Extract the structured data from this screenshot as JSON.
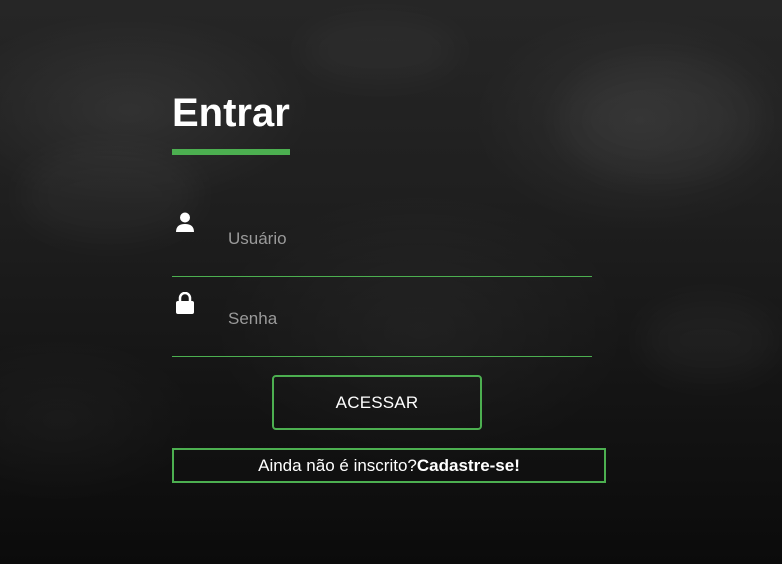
{
  "login": {
    "title": "Entrar",
    "username": {
      "placeholder": "Usuário",
      "value": "",
      "icon": "user-icon"
    },
    "password": {
      "placeholder": "Senha",
      "value": "",
      "icon": "lock-icon"
    },
    "submit_label": "ACESSAR",
    "signup_prompt": "Ainda não é inscrito?",
    "signup_link": "Cadastre-se!"
  },
  "colors": {
    "accent": "#4caf50",
    "background": "#1c1c1c",
    "text": "#ffffff",
    "placeholder": "#9a9a9a"
  }
}
